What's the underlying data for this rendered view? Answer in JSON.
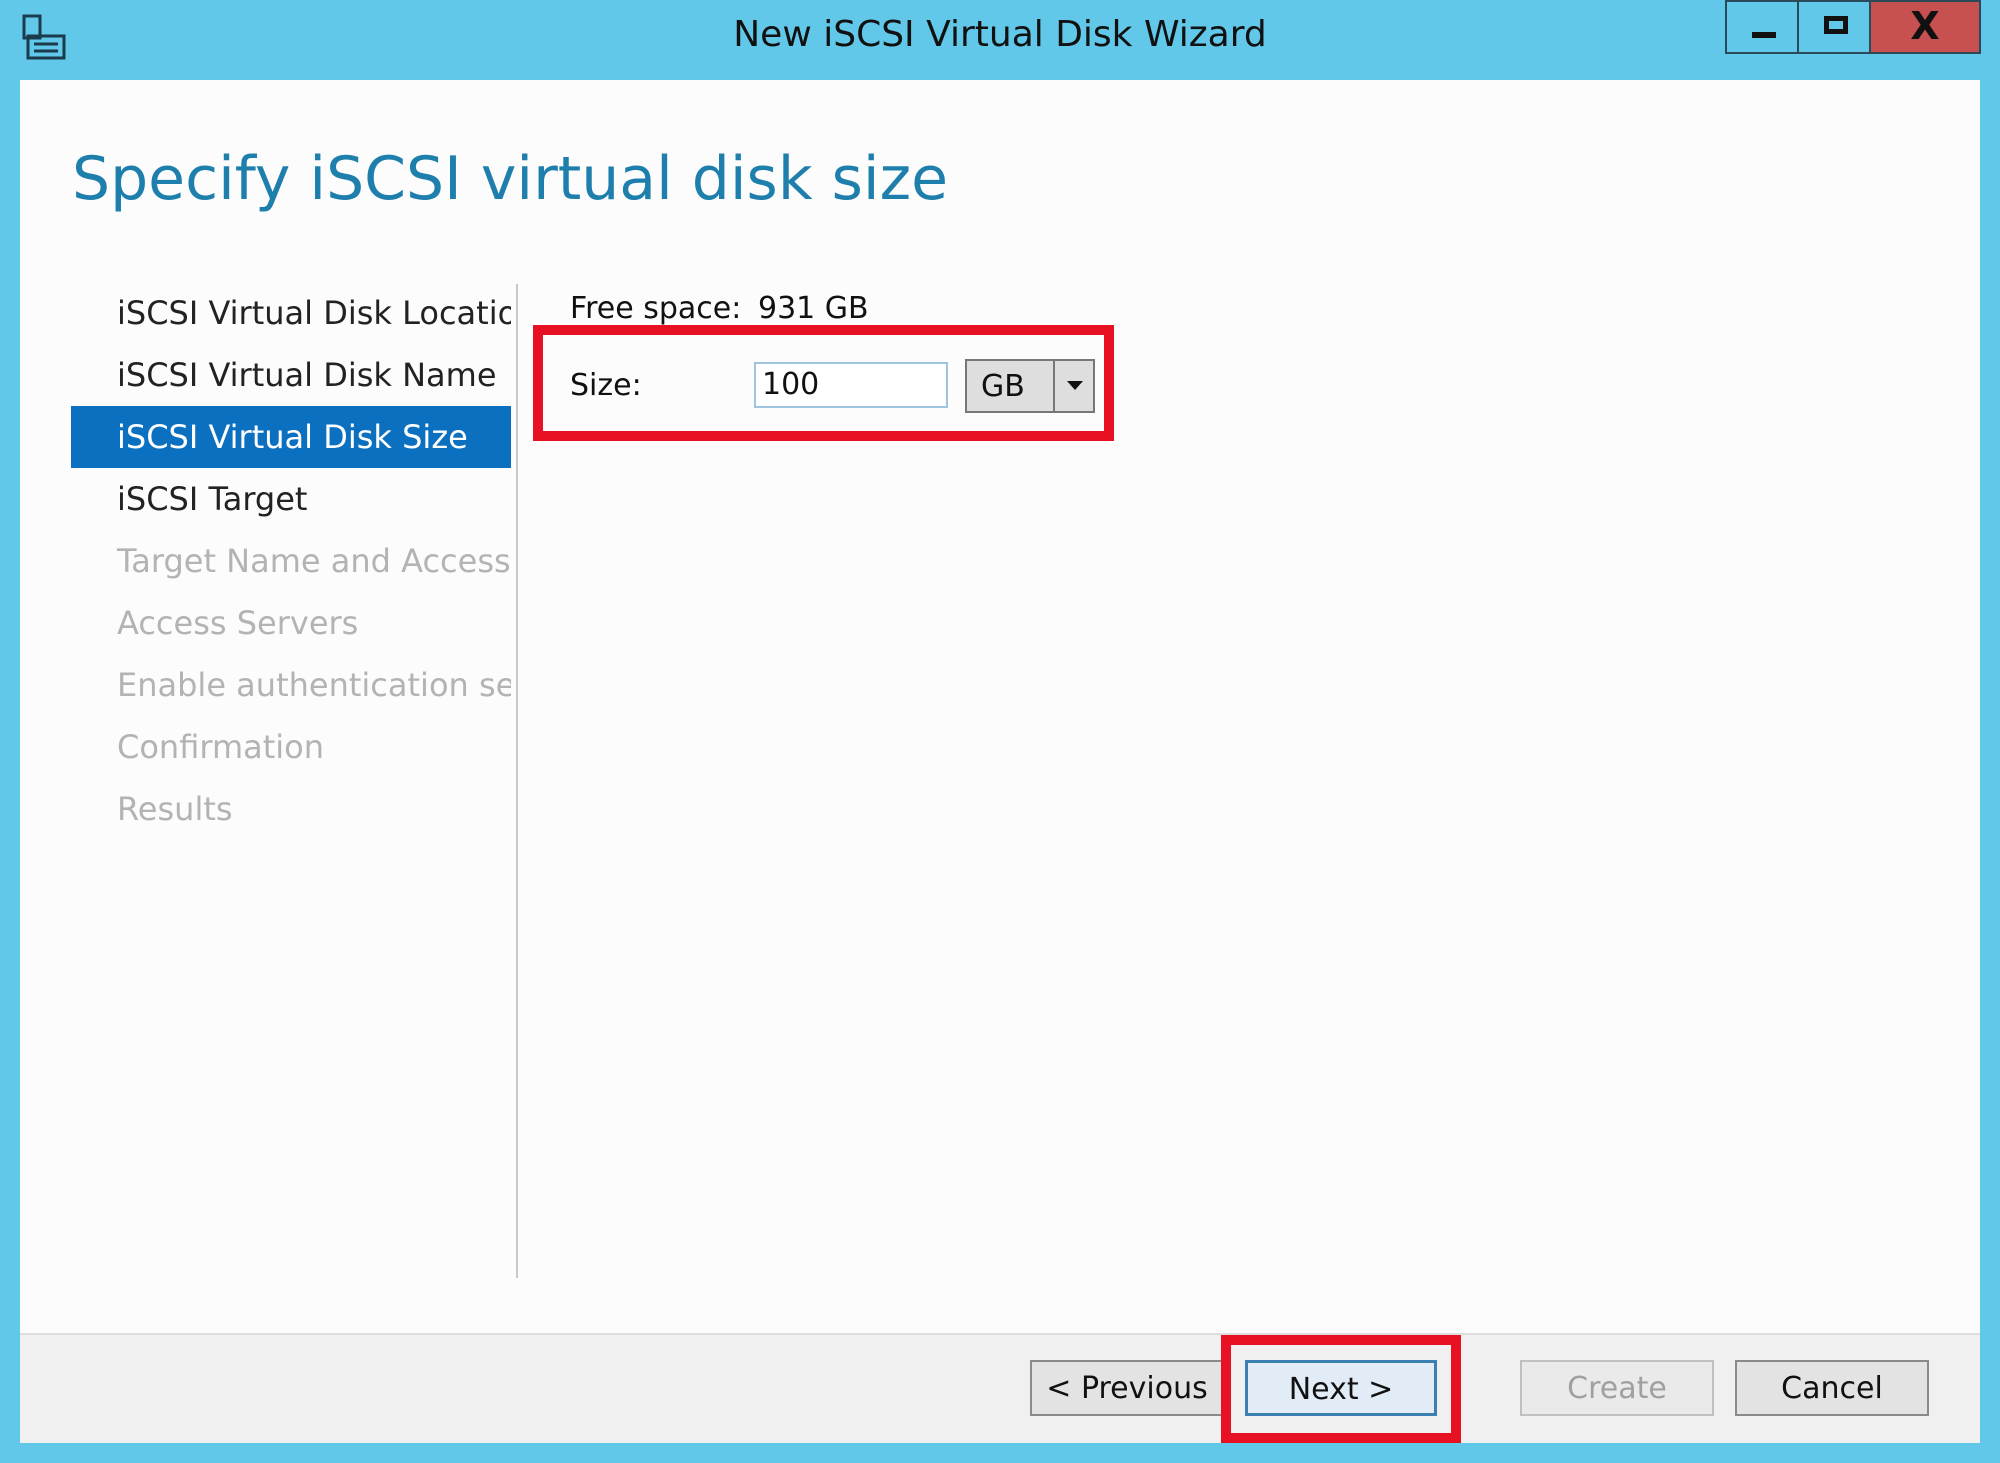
{
  "window": {
    "title": "New iSCSI Virtual Disk Wizard",
    "close_symbol": "X",
    "icon": "server-manager-icon"
  },
  "page": {
    "title": "Specify iSCSI virtual disk size"
  },
  "nav": {
    "items": [
      {
        "label": "iSCSI Virtual Disk Location",
        "state": "completed"
      },
      {
        "label": "iSCSI Virtual Disk Name",
        "state": "completed"
      },
      {
        "label": "iSCSI Virtual Disk Size",
        "state": "active"
      },
      {
        "label": "iSCSI Target",
        "state": "enabled"
      },
      {
        "label": "Target Name and Access",
        "state": "disabled"
      },
      {
        "label": "Access Servers",
        "state": "disabled"
      },
      {
        "label": "Enable authentication ser...",
        "state": "disabled"
      },
      {
        "label": "Confirmation",
        "state": "disabled"
      },
      {
        "label": "Results",
        "state": "disabled"
      }
    ]
  },
  "form": {
    "free_space_label": "Free space:",
    "free_space_value": "931 GB",
    "size_label": "Size:",
    "size_value": "100",
    "unit_value": "GB"
  },
  "buttons": {
    "previous": "< Previous",
    "next": "Next >",
    "create": "Create",
    "cancel": "Cancel"
  },
  "colors": {
    "titlebar": "#62c8ea",
    "accent": "#0c70c0",
    "page_title": "#1e7fad",
    "highlight": "#e81123",
    "close_button": "#c75050"
  }
}
